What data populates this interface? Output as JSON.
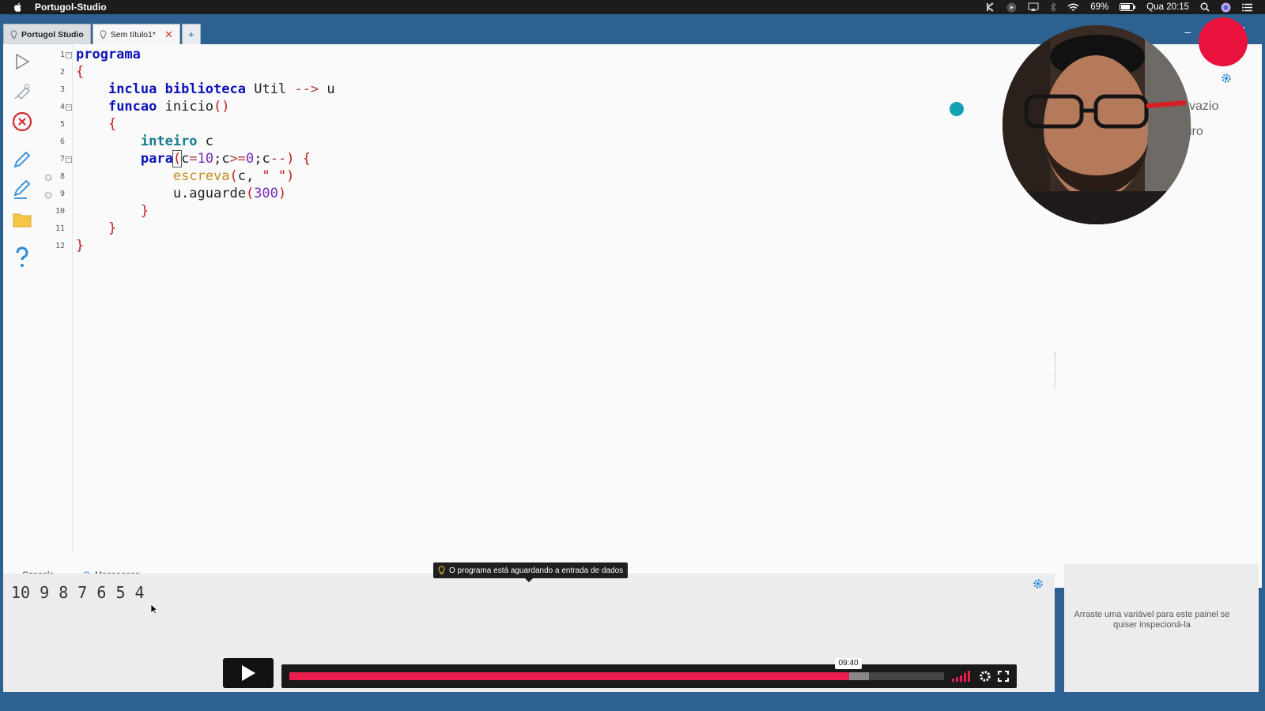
{
  "menubar": {
    "app_name": "Portugol-Studio",
    "battery": "69%",
    "clock": "Qua 20:15"
  },
  "tabs": [
    {
      "label": "Portugol Studio"
    },
    {
      "label": "Sem título1*"
    }
  ],
  "tab_add_label": "+",
  "editor": {
    "line_numbers": [
      "1",
      "2",
      "3",
      "4",
      "5",
      "6",
      "7",
      "8",
      "9",
      "10",
      "11",
      "12"
    ]
  },
  "right_panel": {
    "partial_text_1": "vazio",
    "partial_text_2": "iro"
  },
  "bottom": {
    "console_tab": "Console",
    "messages_tab": "Mensagens",
    "console_output": "10 9 8 7 6 5 4",
    "tooltip": "O programa está aguardando a entrada de dados",
    "inspector_hint": "Arraste uma variável para este painel se quiser inspecioná-la"
  },
  "player": {
    "time": "09:40",
    "progress": 0.855,
    "buffered": 0.885
  },
  "colors": {
    "titlebar": "#2c6191",
    "keyword": "#0b13b8",
    "type_keyword": "#167a8f",
    "function": "#c98c1a",
    "number": "#7a2bbb",
    "brace": "#c21b1b",
    "accent_red": "#ea1c4e"
  },
  "icons": [
    "apple-icon",
    "run-icon",
    "debug-icon",
    "stop-icon",
    "pencil-icon",
    "pencil-edit-icon",
    "folder-icon",
    "help-icon",
    "gear-icon",
    "bulb-icon",
    "bell-icon",
    "play-icon",
    "volume-icon",
    "fullscreen-icon"
  ]
}
